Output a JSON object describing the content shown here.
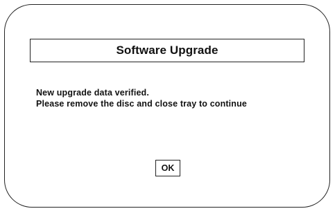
{
  "dialog": {
    "title": "Software Upgrade",
    "message_lines": [
      "New upgrade data verified.",
      "Please remove the disc and close tray to continue"
    ],
    "ok_label": "OK"
  },
  "colors": {
    "background": "#ffffff",
    "border": "#222222",
    "text": "#111111"
  }
}
